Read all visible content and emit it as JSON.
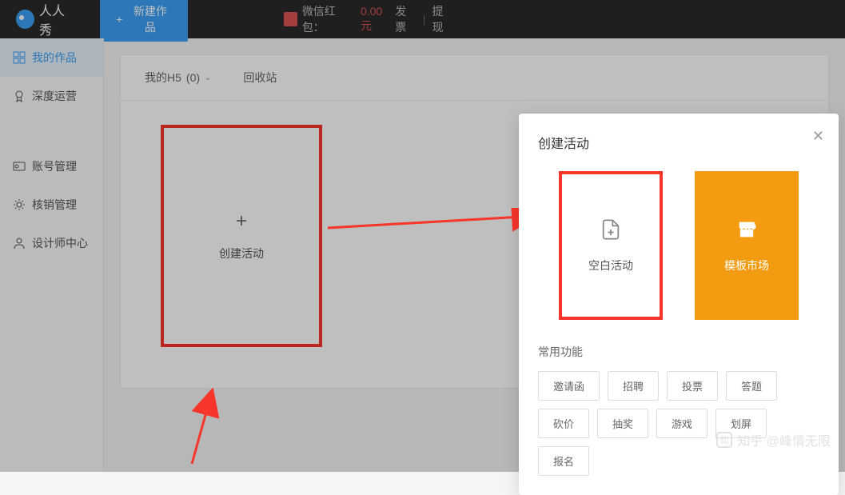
{
  "topbar": {
    "logo_text": "人人秀",
    "new_button": "新建作品",
    "red_envelope_label": "微信红包：",
    "red_envelope_amount": "0.00 元",
    "invoice": "发票",
    "withdraw": "提现"
  },
  "sidebar": {
    "items": [
      {
        "label": "我的作品",
        "icon": "grid"
      },
      {
        "label": "深度运营",
        "icon": "badge"
      },
      {
        "label": "账号管理",
        "icon": "card"
      },
      {
        "label": "核销管理",
        "icon": "gear"
      },
      {
        "label": "设计师中心",
        "icon": "person"
      }
    ]
  },
  "tabs": {
    "my_h5": "我的H5",
    "count": "(0)",
    "recycle": "回收站"
  },
  "create_card": {
    "label": "创建活动"
  },
  "modal": {
    "title": "创建活动",
    "blank_label": "空白活动",
    "market_label": "模板市场",
    "section": "常用功能",
    "tags": [
      "邀请函",
      "招聘",
      "投票",
      "答题",
      "砍价",
      "抽奖",
      "游戏",
      "划屏",
      "报名"
    ]
  },
  "watermark": "知乎 @峰情无限"
}
